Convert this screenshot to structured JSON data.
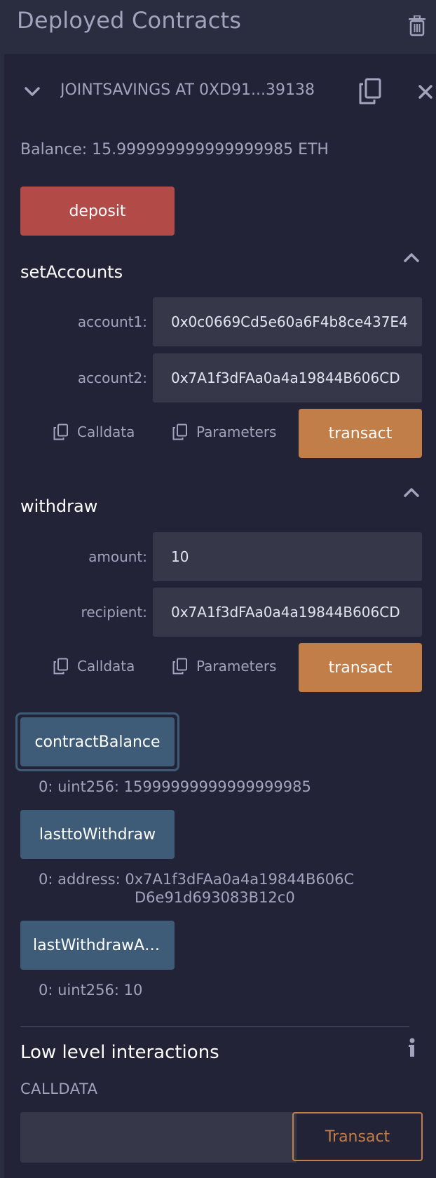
{
  "header": {
    "title": "Deployed Contracts",
    "trash_icon": "trash-icon"
  },
  "contract": {
    "name": "JOINTSAVINGS AT 0XD91...39138",
    "balance": "Balance: 15.999999999999999985 ETH",
    "deposit_label": "deposit"
  },
  "setAccounts": {
    "title": "setAccounts",
    "account1_label": "account1:",
    "account1_value": "0x0c0669Cd5e60a6F4b8ce437E4",
    "account2_label": "account2:",
    "account2_value": "0x7A1f3dFAa0a4a19844B606CD",
    "calldata_label": "Calldata",
    "parameters_label": "Parameters",
    "transact_label": "transact"
  },
  "withdraw": {
    "title": "withdraw",
    "amount_label": "amount:",
    "amount_value": "10",
    "recipient_label": "recipient:",
    "recipient_value": "0x7A1f3dFAa0a4a19844B606CD",
    "calldata_label": "Calldata",
    "parameters_label": "Parameters",
    "transact_label": "transact"
  },
  "calls": [
    {
      "label": "contractBalance",
      "output": "0: uint256: 15999999999999999985"
    },
    {
      "label": "lasttoWithdraw",
      "output_line1": "0:  address: 0x7A1f3dFAa0a4a19844B606C",
      "output_line2": "D6e91d693083B12c0"
    },
    {
      "label": "lastWithdrawAmount",
      "output": "0: uint256: 10"
    }
  ],
  "low_level": {
    "title": "Low level interactions",
    "calldata_label": "CALLDATA",
    "calldata_value": "",
    "transact_label": "Transact"
  },
  "colors": {
    "background": "#2a2c3f",
    "panel": "#222336",
    "deposit": "#b24a48",
    "transact": "#c27e48",
    "call": "#3e5b77"
  }
}
